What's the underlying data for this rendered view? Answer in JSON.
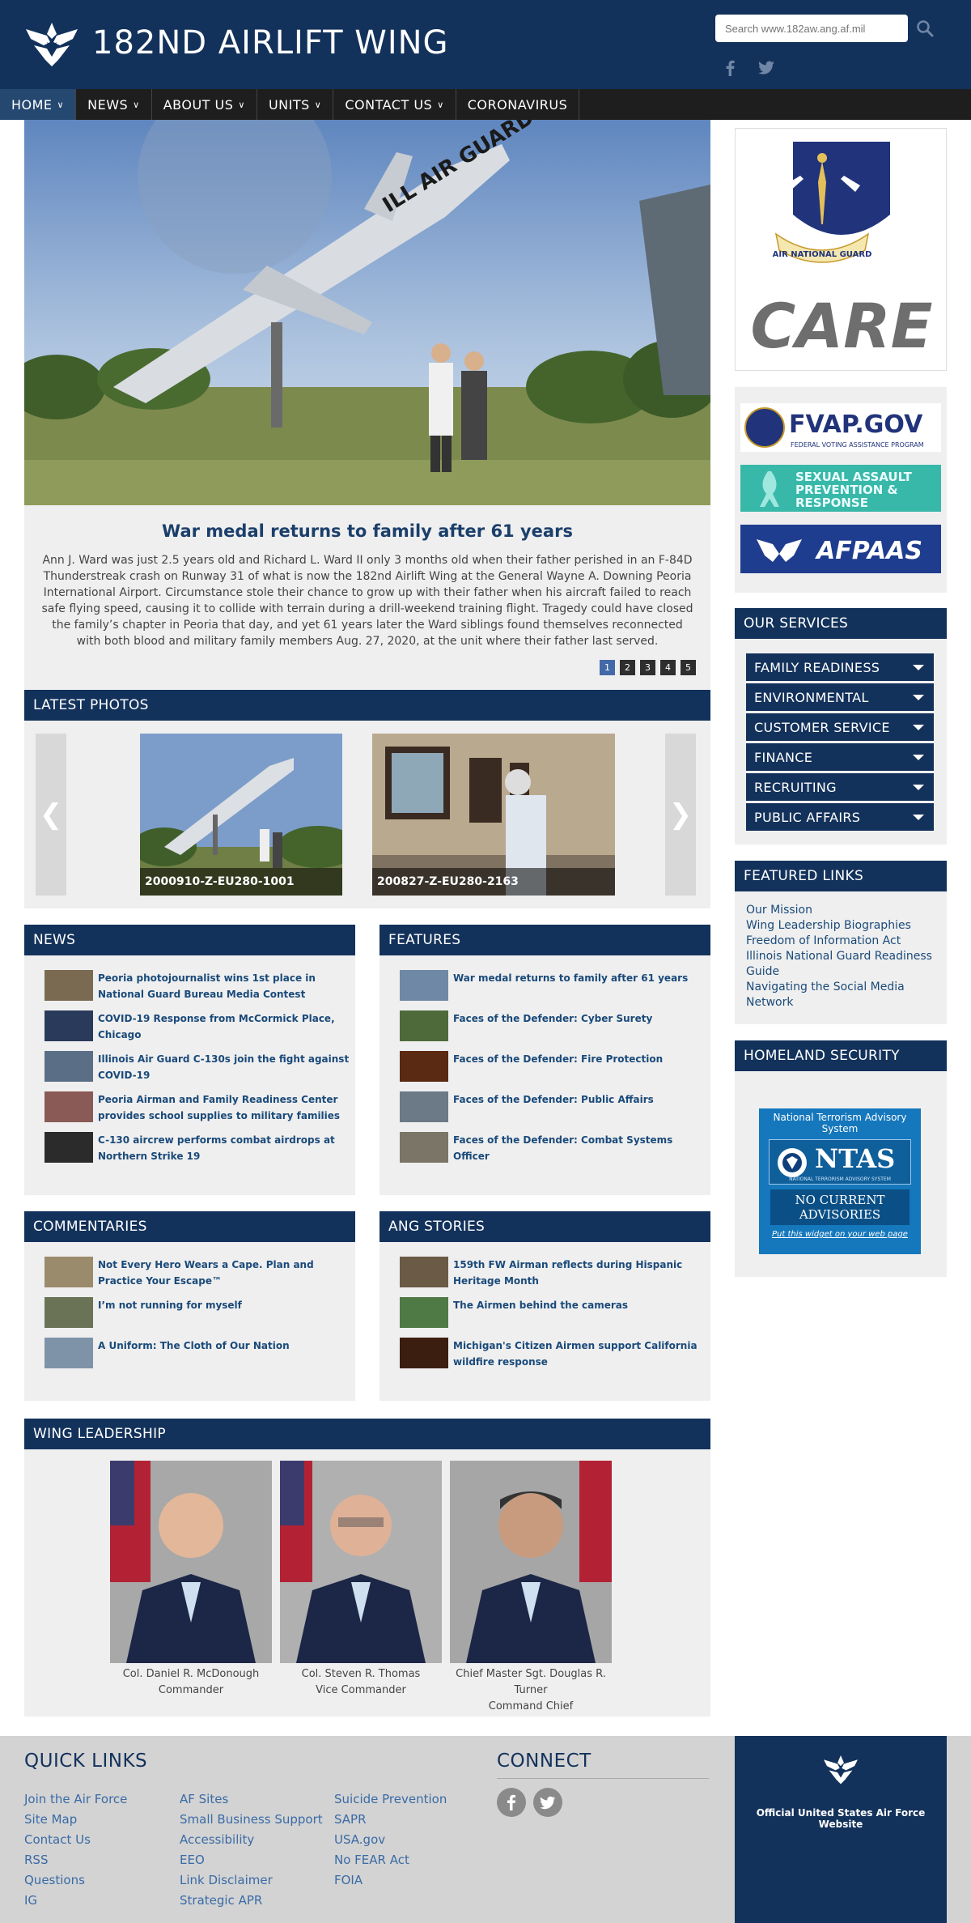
{
  "header": {
    "site_title": "182ND AIRLIFT WING",
    "search_placeholder": "Search www.182aw.ang.af.mil",
    "colors": {
      "brand": "#13325b",
      "nav": "#1e1e1e",
      "active_nav": "#254870"
    }
  },
  "nav": {
    "items": [
      {
        "label": "HOME",
        "has_dropdown": true,
        "active": true
      },
      {
        "label": "NEWS",
        "has_dropdown": true
      },
      {
        "label": "ABOUT US",
        "has_dropdown": true
      },
      {
        "label": "UNITS",
        "has_dropdown": true
      },
      {
        "label": "CONTACT US",
        "has_dropdown": true
      },
      {
        "label": "CORONAVIRUS",
        "has_dropdown": false
      }
    ]
  },
  "hero": {
    "title": "War medal returns to family after 61 years",
    "text": "Ann J. Ward was just 2.5 years old and Richard L. Ward II only 3 months old when their father perished in an F-84D Thunderstreak crash on Runway 31 of what is now the 182nd Airlift Wing at the General Wayne A. Downing Peoria International Airport. Circumstance stole their chance to grow up with their father when his aircraft failed to reach safe flying speed, causing it to collide with terrain during a drill-weekend training flight. Tragedy could have closed the family’s chapter in Peoria that day, and yet 61 years later the Ward siblings found themselves reconnected with both blood and military family members Aug. 27, 2020, at the unit where their father last served.",
    "pages": [
      "1",
      "2",
      "3",
      "4",
      "5"
    ],
    "active_page": "1",
    "aircraft_text": "ILL AIR GUARD"
  },
  "latest_photos": {
    "heading": "LATEST PHOTOS",
    "items": [
      {
        "label": "2000910-Z-EU280-1001"
      },
      {
        "label": "200827-Z-EU280-2163"
      }
    ]
  },
  "news": {
    "heading": "NEWS",
    "items": [
      "Peoria photojournalist wins 1st place in National Guard Bureau Media Contest",
      "COVID-19 Response from McCormick Place, Chicago",
      "Illinois Air Guard C-130s join the fight against COVID-19",
      "Peoria Airman and Family Readiness Center provides school supplies to military families",
      "C-130 aircrew performs combat airdrops at Northern Strike 19"
    ]
  },
  "features": {
    "heading": "FEATURES",
    "items": [
      "War medal returns to family after 61 years",
      "Faces of the Defender: Cyber Surety",
      "Faces of the Defender: Fire Protection",
      "Faces of the Defender: Public Affairs",
      "Faces of the Defender: Combat Systems Officer"
    ]
  },
  "commentaries": {
    "heading": "COMMENTARIES",
    "items": [
      "Not Every Hero Wears a Cape. Plan and Practice Your Escape™",
      "I’m not running for myself",
      "A Uniform: The Cloth of Our Nation"
    ]
  },
  "ang_stories": {
    "heading": "ANG STORIES",
    "items": [
      "159th FW Airman reflects during Hispanic Heritage Month",
      "The Airmen behind the cameras",
      "Michigan's Citizen Airmen support California wildfire response"
    ]
  },
  "leadership": {
    "heading": "WING LEADERSHIP",
    "people": [
      {
        "name": "Col. Daniel R. McDonough",
        "role": "Commander"
      },
      {
        "name": "Col. Steven R. Thomas",
        "role": "Vice Commander"
      },
      {
        "name": "Chief Master Sgt. Douglas R. Turner",
        "role": "Command Chief"
      }
    ]
  },
  "sidebar": {
    "care": {
      "seal_text": "AIR NATIONAL GUARD",
      "big_text": "CARE"
    },
    "ads": {
      "fvap": {
        "title": "FVAP.GOV",
        "subtitle": "FEDERAL VOTING ASSISTANCE PROGRAM"
      },
      "sapr": {
        "line1": "SEXUAL ASSAULT",
        "line2": "PREVENTION &",
        "line3": "RESPONSE"
      },
      "afpaas": {
        "title": "AFPAAS"
      }
    },
    "services": {
      "heading": "OUR SERVICES",
      "items": [
        "FAMILY READINESS",
        "ENVIRONMENTAL",
        "CUSTOMER SERVICE",
        "FINANCE",
        "RECRUITING",
        "PUBLIC AFFAIRS"
      ]
    },
    "featured": {
      "heading": "FEATURED LINKS",
      "items": [
        "Our Mission",
        "Wing Leadership Biographies",
        "Freedom of Information Act",
        "Illinois National Guard Readiness Guide",
        "Navigating the Social Media Network"
      ]
    },
    "homeland": {
      "heading": "HOMELAND SECURITY",
      "ntas_top": "National Terrorism Advisory System",
      "ntas_logo": "NTAS",
      "ntas_sub": "NATIONAL TERRORISM ADVISORY SYSTEM",
      "ntas_status_1": "NO CURRENT",
      "ntas_status_2": "ADVISORIES",
      "ntas_link": "Put this widget on your web page"
    }
  },
  "footer": {
    "quick_links_title": "QUICK LINKS",
    "col1": [
      "Join the Air Force",
      "Site Map",
      "Contact Us",
      "RSS",
      "Questions",
      "IG"
    ],
    "col2": [
      "AF Sites",
      "Small Business Support",
      "Accessibility",
      "EEO",
      "Link Disclaimer",
      "Strategic APR"
    ],
    "col3": [
      "Suicide Prevention",
      "SAPR",
      "USA.gov",
      "No FEAR Act",
      "FOIA"
    ],
    "connect_title": "CONNECT",
    "af_text": "Official United States Air Force Website"
  }
}
